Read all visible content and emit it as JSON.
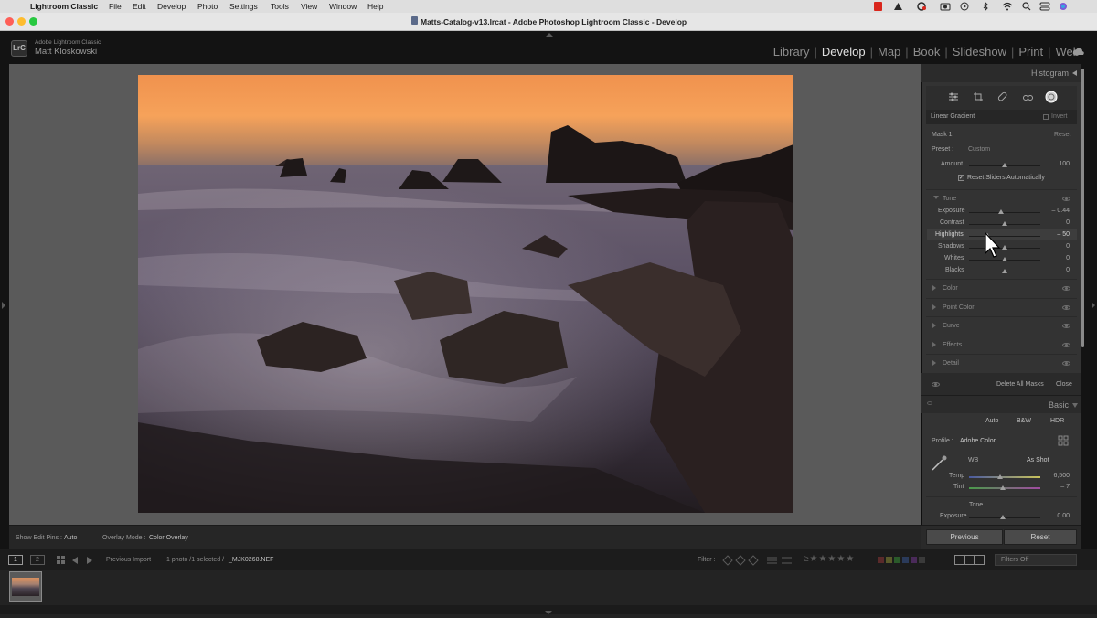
{
  "menubar": {
    "app": "Lightroom Classic",
    "items": [
      "File",
      "Edit",
      "Develop",
      "Photo",
      "Settings",
      "Tools",
      "View",
      "Window",
      "Help"
    ]
  },
  "window": {
    "title": "Matts-Catalog-v13.lrcat - Adobe Photoshop Lightroom Classic - Develop"
  },
  "identity": {
    "product": "Adobe Lightroom Classic",
    "user": "Matt Kloskowski",
    "badge": "LrC"
  },
  "modules": {
    "library": "Library",
    "develop": "Develop",
    "map": "Map",
    "book": "Book",
    "slideshow": "Slideshow",
    "print": "Print",
    "web": "Web"
  },
  "panel": {
    "histogram": "Histogram",
    "mask_tool": {
      "label": "Linear Gradient",
      "invert": "Invert"
    },
    "mask": {
      "name": "Mask 1",
      "reset": "Reset",
      "preset_label": "Preset :",
      "preset_value": "Custom",
      "amount_label": "Amount",
      "amount_value": "100",
      "reset_sliders": "Reset Sliders Automatically"
    },
    "tone": {
      "title": "Tone",
      "sliders": [
        {
          "label": "Exposure",
          "value": "– 0.44"
        },
        {
          "label": "Contrast",
          "value": "0"
        },
        {
          "label": "Highlights",
          "value": "– 50"
        },
        {
          "label": "Shadows",
          "value": "0"
        },
        {
          "label": "Whites",
          "value": "0"
        },
        {
          "label": "Blacks",
          "value": "0"
        }
      ]
    },
    "sections": [
      "Color",
      "Point Color",
      "Curve",
      "Effects",
      "Detail"
    ],
    "delete_all_masks": "Delete All Masks",
    "close": "Close",
    "basic": {
      "title": "Basic",
      "auto": "Auto",
      "bw": "B&W",
      "hdr": "HDR",
      "profile_label": "Profile :",
      "profile_value": "Adobe Color",
      "wb_label": "WB",
      "wb_value": "As Shot",
      "temp_label": "Temp",
      "temp_value": "6,500",
      "tint_label": "Tint",
      "tint_value": "– 7",
      "tone_label": "Tone",
      "exposure_label": "Exposure",
      "exposure_value": "0.00"
    },
    "previous": "Previous",
    "reset": "Reset"
  },
  "toolbar": {
    "show_edit_pins_label": "Show Edit Pins :",
    "show_edit_pins_value": "Auto",
    "overlay_mode_label": "Overlay Mode :",
    "overlay_mode_value": "Color Overlay"
  },
  "filmbar": {
    "view1": "1",
    "view2": "2",
    "source": "Previous Import",
    "selection": "1 photo /1 selected /",
    "filename": "_MJK0268.NEF",
    "filter_label": "Filter :",
    "filters_off": "Filters Off"
  },
  "colors": {
    "accent": "#e0e0e0",
    "panel": "#333333",
    "viewer": "#5a5a5a"
  }
}
